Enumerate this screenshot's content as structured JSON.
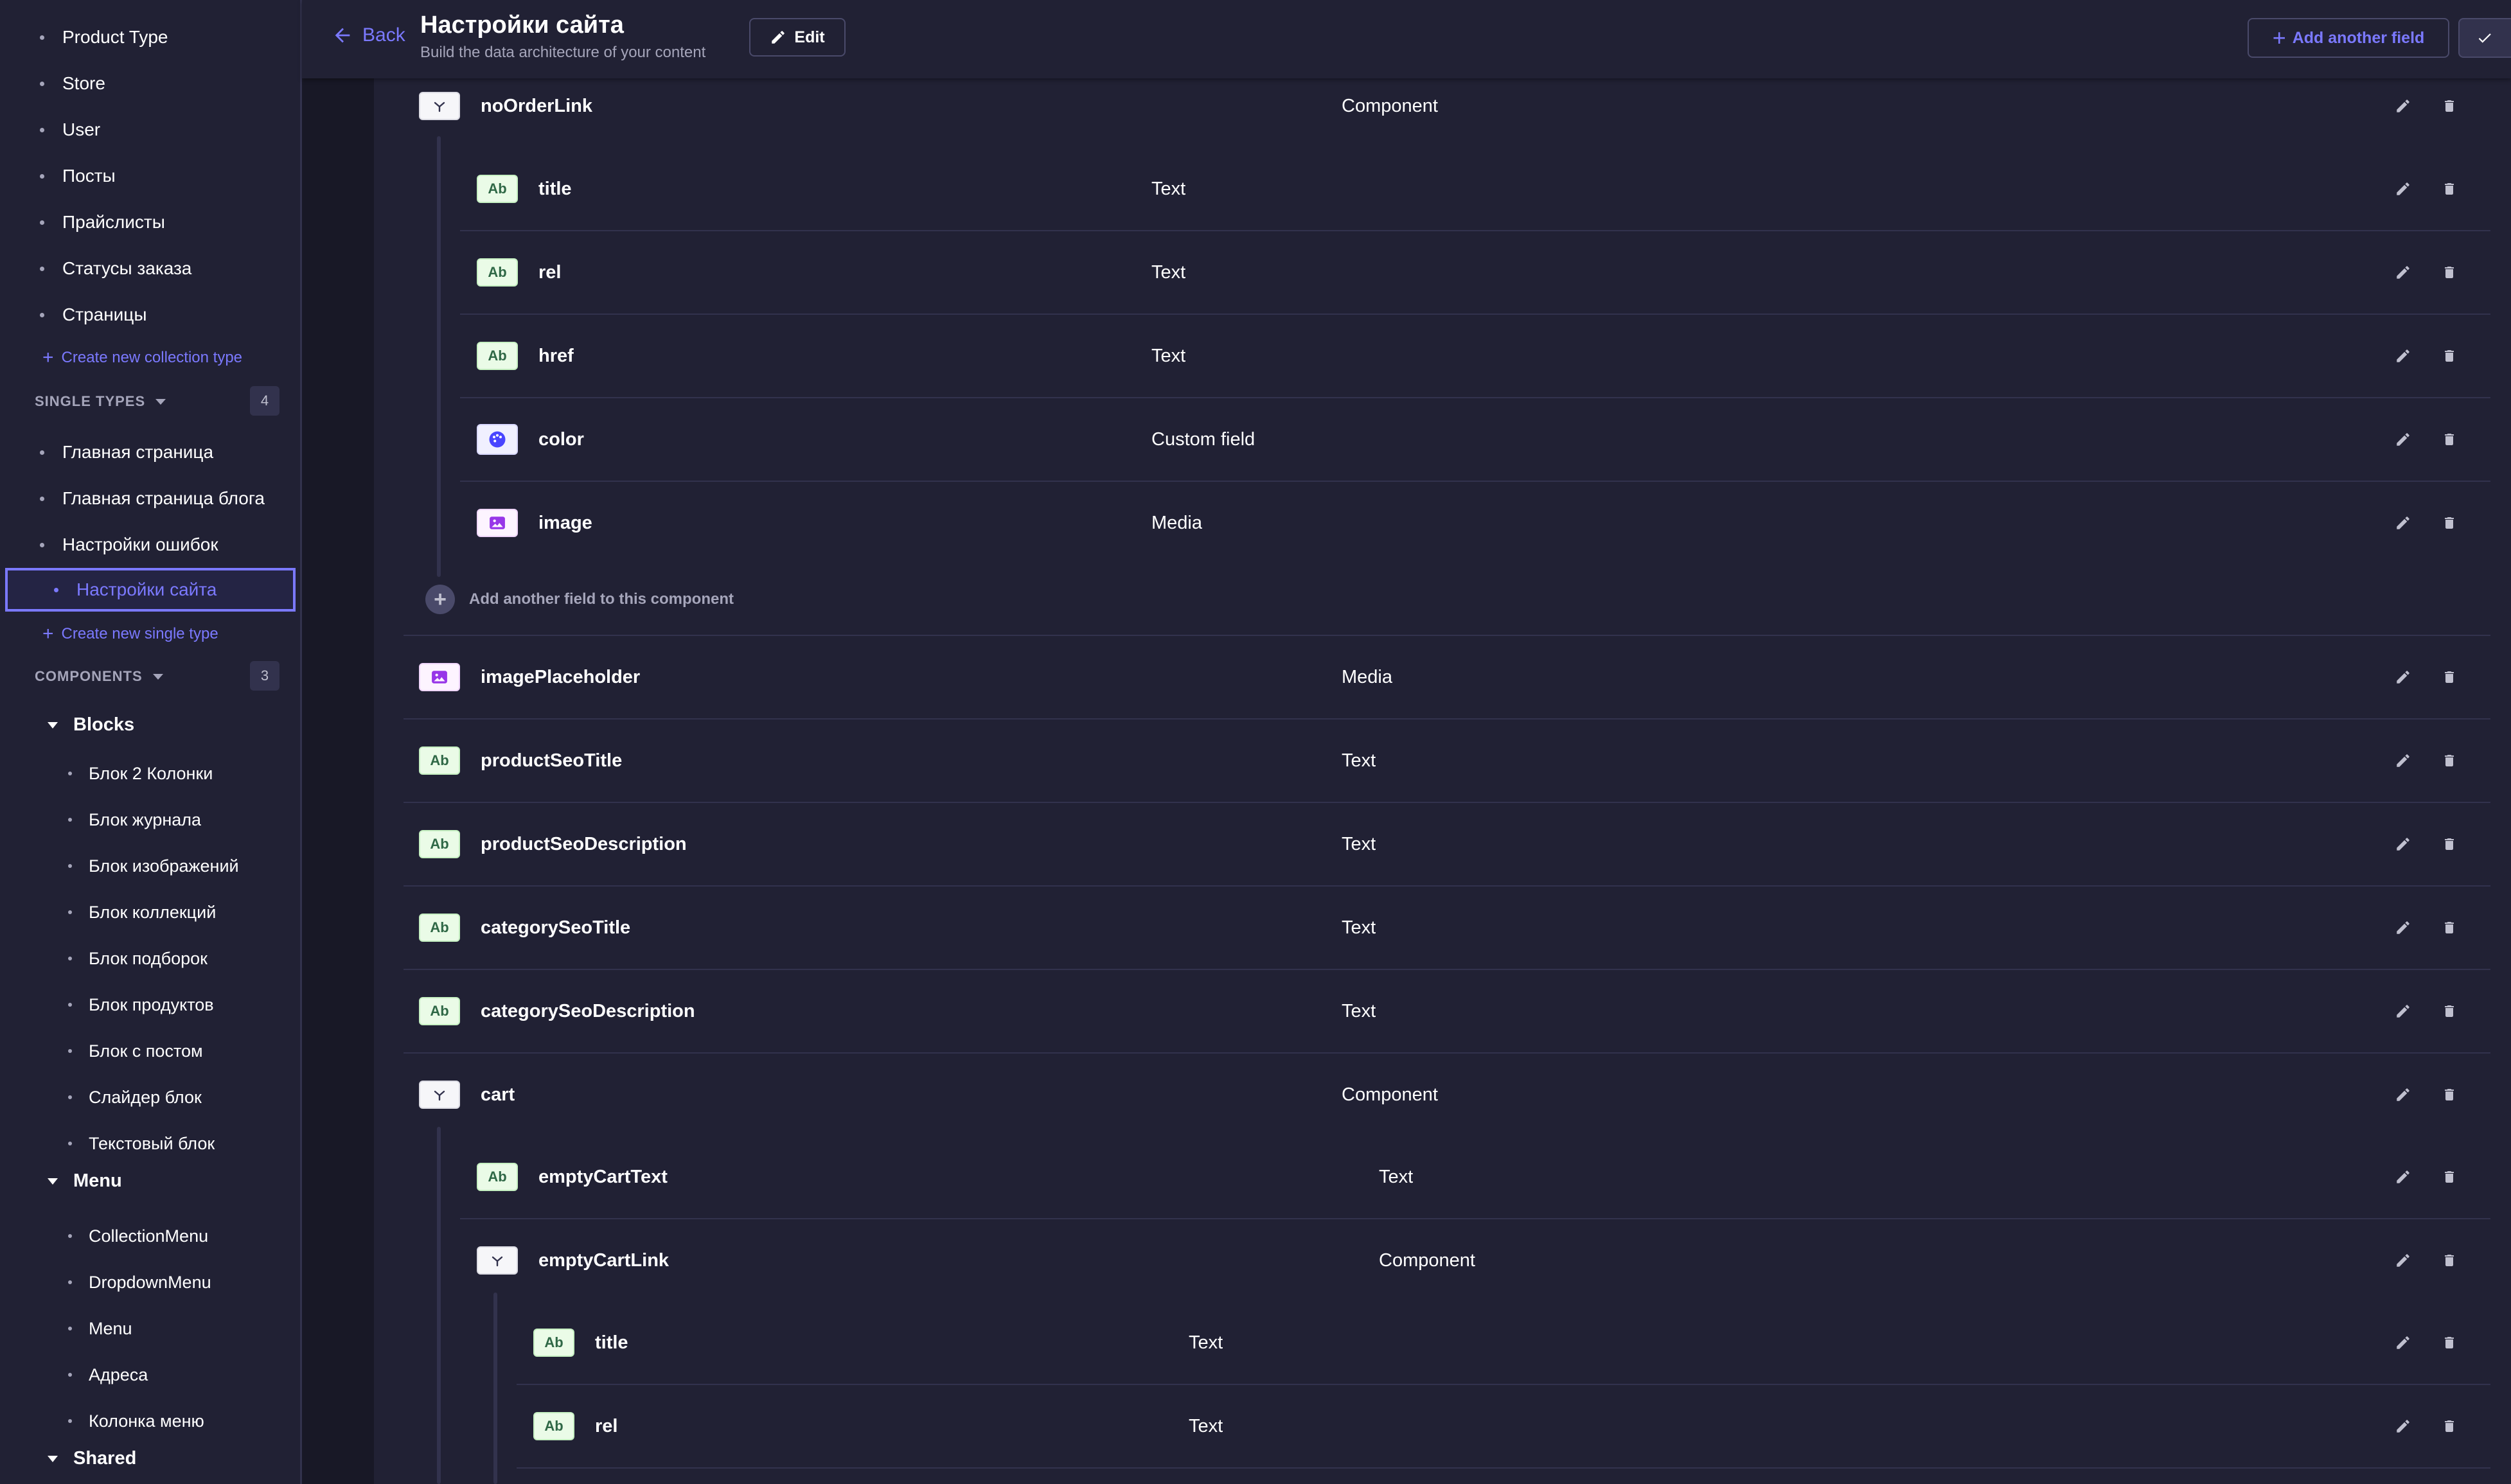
{
  "sidebar": {
    "collection_types": [
      "Product Type",
      "Store",
      "User",
      "Посты",
      "Прайслисты",
      "Статусы заказа",
      "Страницы"
    ],
    "create_collection_label": "Create new collection type",
    "single_types_label": "SINGLE TYPES",
    "single_types_count": "4",
    "single_types": [
      "Главная страница",
      "Главная страница блога",
      "Настройки ошибок",
      "Настройки сайта"
    ],
    "create_single_label": "Create new single type",
    "components_label": "COMPONENTS",
    "components_count": "3",
    "groups": [
      {
        "name": "Blocks",
        "items": [
          "Блок 2 Колонки",
          "Блок журнала",
          "Блок изображений",
          "Блок коллекций",
          "Блок подборок",
          "Блок продуктов",
          "Блок с постом",
          "Слайдер блок",
          "Текстовый блок"
        ]
      },
      {
        "name": "Menu",
        "items": [
          "CollectionMenu",
          "DropdownMenu",
          "Menu",
          "Адреса",
          "Колонка меню"
        ]
      },
      {
        "name": "Shared",
        "items": []
      }
    ]
  },
  "header": {
    "back_label": "Back",
    "title": "Настройки сайта",
    "subtitle": "Build the data architecture of your content",
    "edit_label": "Edit",
    "add_field_label": "Add another field"
  },
  "fields": [
    {
      "name": "noOrderLink",
      "type": "Component",
      "icon": "component-icon",
      "badge": ""
    },
    {
      "name": "title",
      "type": "Text",
      "icon": "text-icon",
      "badge": "Ab"
    },
    {
      "name": "rel",
      "type": "Text",
      "icon": "text-icon",
      "badge": "Ab"
    },
    {
      "name": "href",
      "type": "Text",
      "icon": "text-icon",
      "badge": "Ab"
    },
    {
      "name": "color",
      "type": "Custom field",
      "icon": "palette-icon",
      "badge": ""
    },
    {
      "name": "image",
      "type": "Media",
      "icon": "media-icon",
      "badge": ""
    },
    {
      "name": "imagePlaceholder",
      "type": "Media",
      "icon": "media-icon",
      "badge": ""
    },
    {
      "name": "productSeoTitle",
      "type": "Text",
      "icon": "text-icon",
      "badge": "Ab"
    },
    {
      "name": "productSeoDescription",
      "type": "Text",
      "icon": "text-icon",
      "badge": "Ab"
    },
    {
      "name": "categorySeoTitle",
      "type": "Text",
      "icon": "text-icon",
      "badge": "Ab"
    },
    {
      "name": "categorySeoDescription",
      "type": "Text",
      "icon": "text-icon",
      "badge": "Ab"
    },
    {
      "name": "cart",
      "type": "Component",
      "icon": "component-icon",
      "badge": ""
    },
    {
      "name": "emptyCartText",
      "type": "Text",
      "icon": "text-icon",
      "badge": "Ab"
    },
    {
      "name": "emptyCartLink",
      "type": "Component",
      "icon": "component-icon",
      "badge": ""
    },
    {
      "name": "title",
      "type": "Text",
      "icon": "text-icon",
      "badge": "Ab"
    },
    {
      "name": "rel",
      "type": "Text",
      "icon": "text-icon",
      "badge": "Ab"
    }
  ],
  "add_component_field_label": "Add another field to this component",
  "colors": {
    "accent": "#7b79ff",
    "background": "#181826",
    "panel": "#212134",
    "border": "#32324d"
  }
}
